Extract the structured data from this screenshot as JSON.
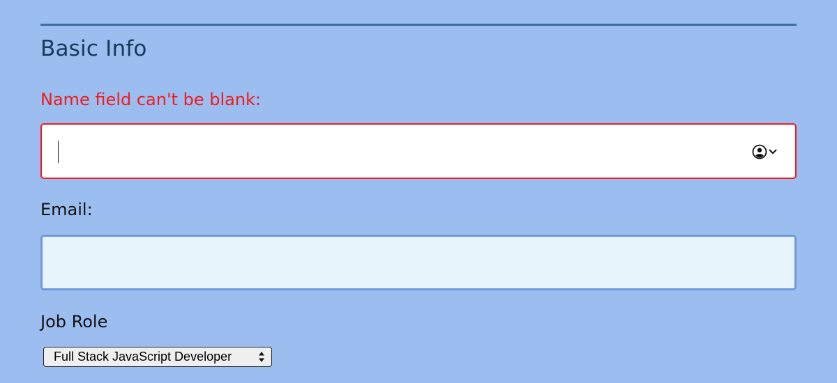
{
  "section": {
    "legend": "Basic Info"
  },
  "name_field": {
    "label": "Name field can't be blank:",
    "value": "",
    "state": "error",
    "autofill_icon": "contact-card-icon",
    "dropdown_icon": "chevron-down-icon"
  },
  "email_field": {
    "label": "Email:",
    "value": ""
  },
  "job_role": {
    "label": "Job Role",
    "selected": "Full Stack JavaScript Developer",
    "icon": "select-arrows-icon"
  },
  "colors": {
    "page_background": "#9cbdef",
    "error": "#f11a1a",
    "legend_text": "#153a5c",
    "divider": "#3f6f9a",
    "email_background": "#e8f4fb",
    "email_border": "#6f9ad9"
  }
}
